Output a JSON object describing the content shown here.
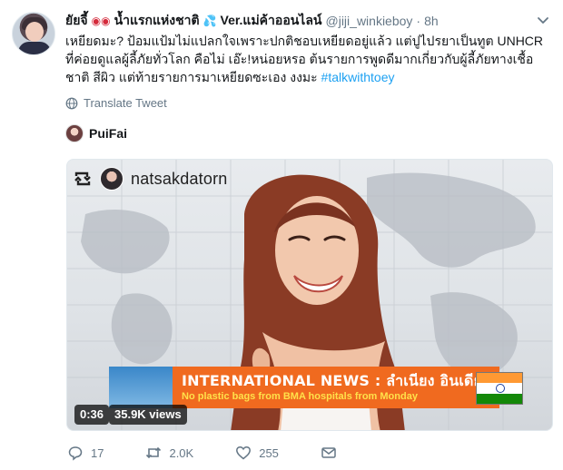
{
  "tweet": {
    "display_name_part1": "ยัยจี้",
    "display_name_part2": "น้ำแรกแห่งชาติ",
    "display_name_part3": "Ver.แม่ค้าออนไลน์",
    "handle": "@jiji_winkieboy",
    "separator": "·",
    "time": "8h",
    "text_line1": "เหยียดมะ? ป้อมแป้มไม่แปลกใจเพราะปกติชอบเหยียดอยู่แล้ว แต่ปูไปรยาเป็นทูต UNHCR",
    "text_line2": "ที่ค่อยดูแลผู้ลี้ภัยทั่วโลก คือไม่ เอ๊ะ!หน่อยหรอ ต้นรายการพูดดีมากเกี่ยวกับผู้ลี้ภัยทางเชื้อ",
    "text_line3_plain": "ชาติ สีผิว แต่ท้ายรายการมาเหยียดซะเอง งงมะ ",
    "hashtag": "#talkwithtoey",
    "translate_label": "Translate Tweet",
    "mentioned_user": "PuiFai",
    "icons": {
      "caret": "chevron-down-icon",
      "translate": "globe-icon",
      "reply": "reply-icon",
      "retweet": "retweet-icon",
      "like": "heart-icon",
      "dm": "envelope-icon"
    }
  },
  "media": {
    "repost_username": "natsakdatorn",
    "ticker_title": "INTERNATIONAL NEWS : ลำเนียง อินเดีย",
    "ticker_subtitle": "No plastic bags from BMA hospitals from Monday",
    "duration": "0:36",
    "views": "35.9K views"
  },
  "actions": {
    "reply_count": "17",
    "retweet_count": "2.0K",
    "like_count": "255"
  },
  "colors": {
    "accent": "#1da1f2",
    "muted": "#657786",
    "ticker_orange": "#f06a1f",
    "ticker_yellow": "#ffe14a"
  }
}
